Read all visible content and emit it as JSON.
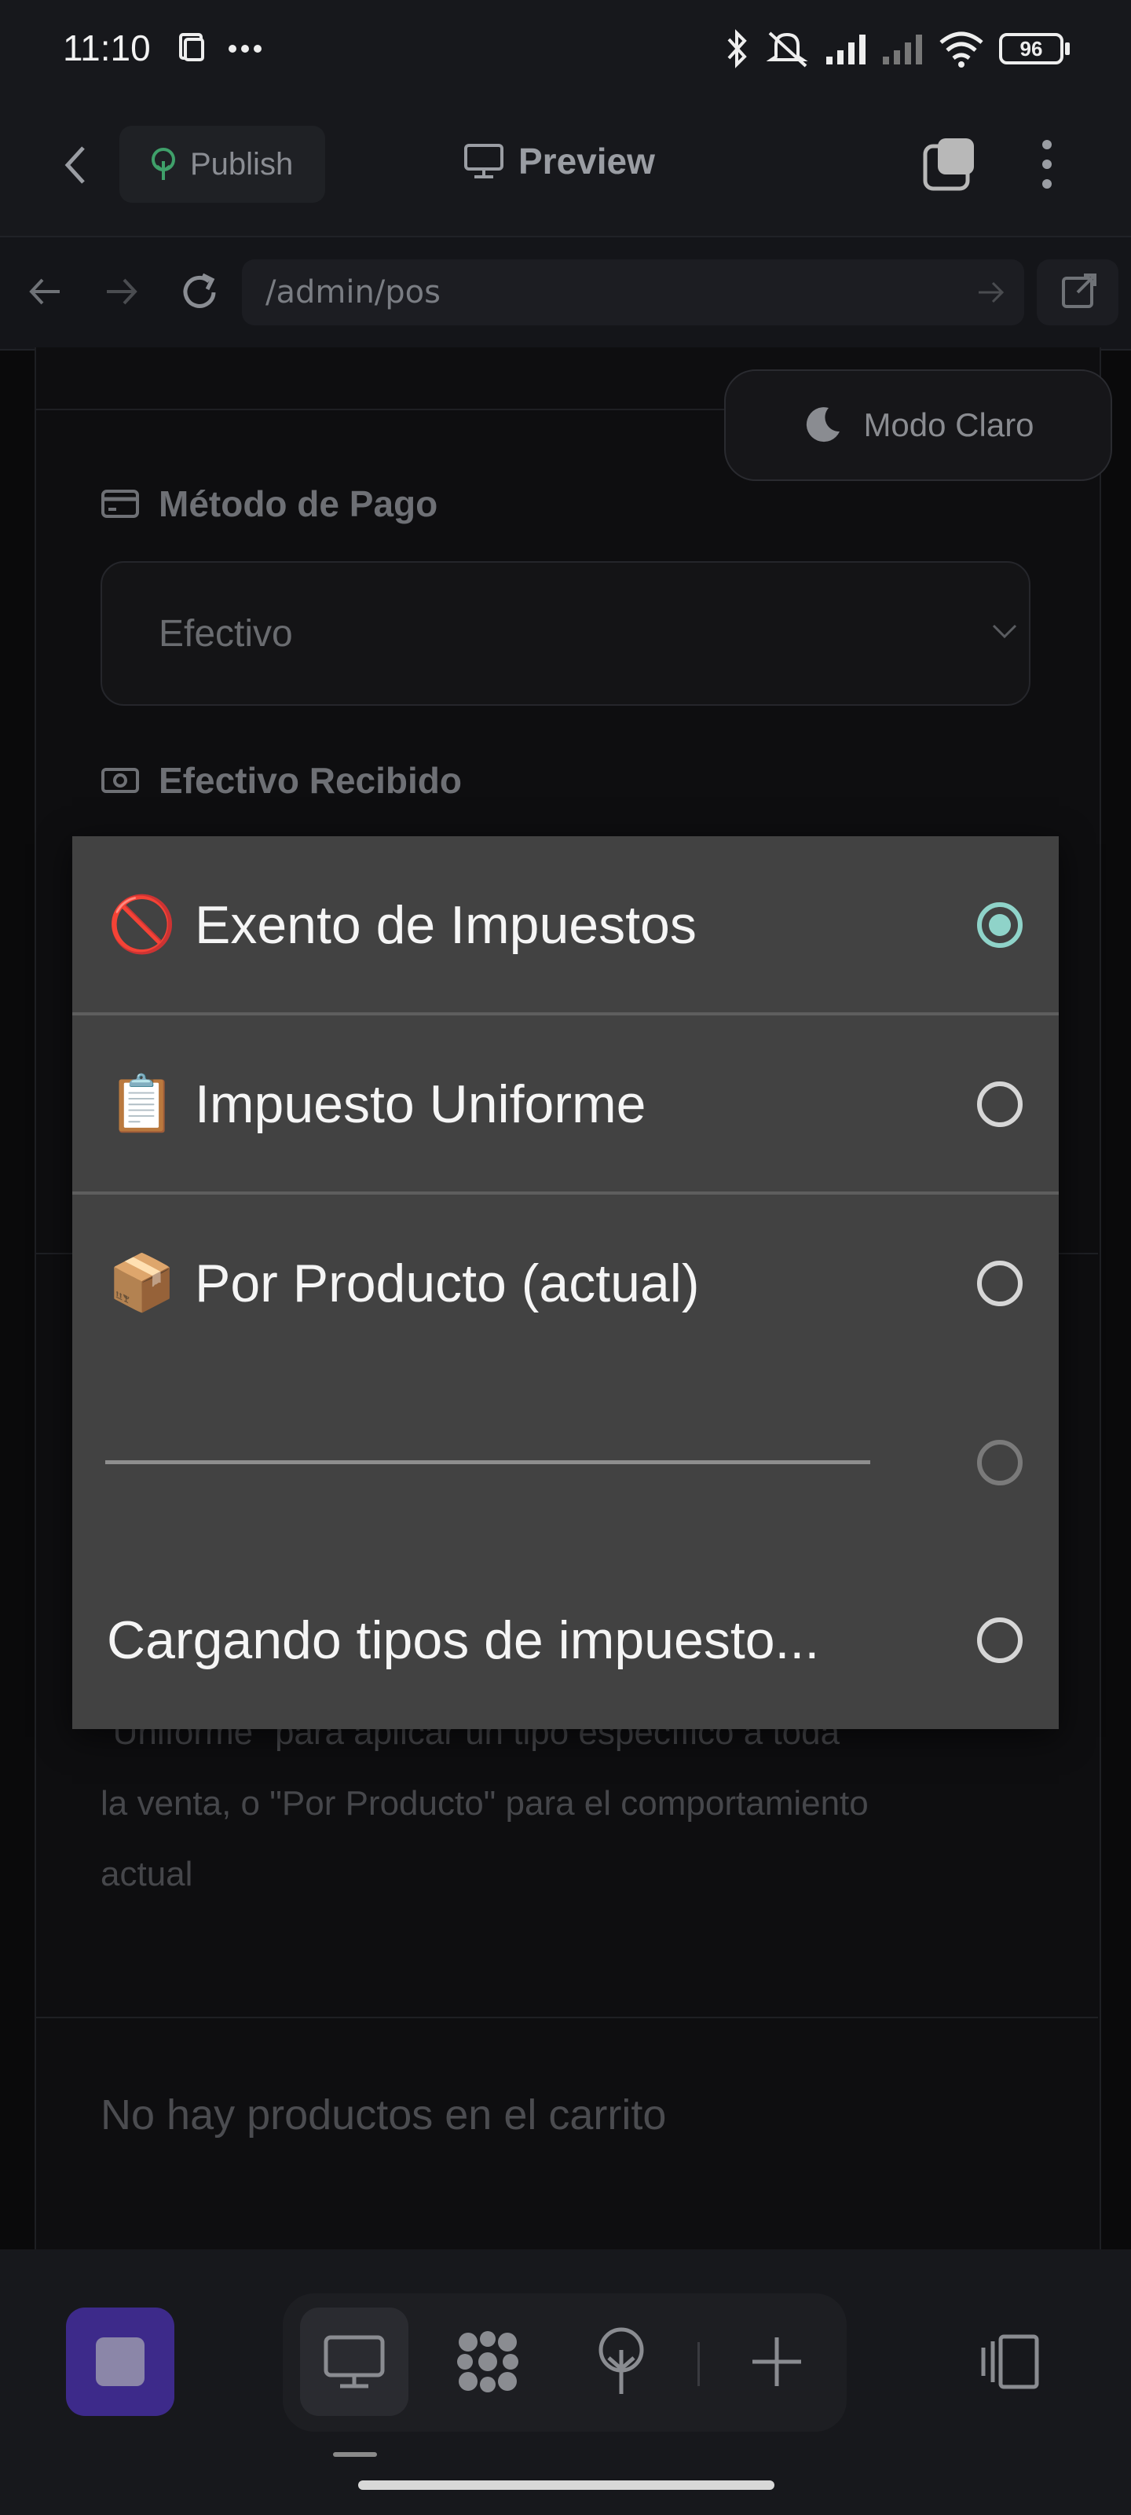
{
  "status_bar": {
    "time": "11:10",
    "battery": "96",
    "icons": [
      "screenshot-icon",
      "more-dots-icon",
      "bluetooth-icon",
      "mute-icon",
      "signal-icon",
      "signal-2-icon",
      "wifi-icon",
      "battery-icon"
    ]
  },
  "app_header": {
    "publish_label": "Publish",
    "preview_label": "Preview"
  },
  "browser": {
    "url": "/admin/pos"
  },
  "page": {
    "theme_toggle_label": "Modo Claro",
    "payment_method_label": "Método de Pago",
    "payment_method_value": "Efectivo",
    "cash_received_label": "Efectivo Recibido",
    "helper_lines": [
      "\"Uniforme\" para aplicar un tipo específico a toda",
      "la venta, o \"Por Producto\" para el comportamiento",
      "actual"
    ],
    "empty_cart_text": "No hay productos en el carrito"
  },
  "tax_dialog": {
    "options": [
      {
        "emoji": "🚫",
        "label": "Exento de Impuestos",
        "selected": true
      },
      {
        "emoji": "📋",
        "label": "Impuesto Uniforme",
        "selected": false
      },
      {
        "emoji": "📦",
        "label": "Por Producto (actual)",
        "selected": false
      },
      {
        "emoji": "",
        "label": "",
        "selected": false
      },
      {
        "emoji": "",
        "label": "Cargando tipos de impuesto...",
        "selected": false
      }
    ]
  },
  "colors": {
    "radio_selected": "#8fd3c9",
    "accent_purple": "#3d2a8a",
    "modal_bg": "#424242"
  }
}
